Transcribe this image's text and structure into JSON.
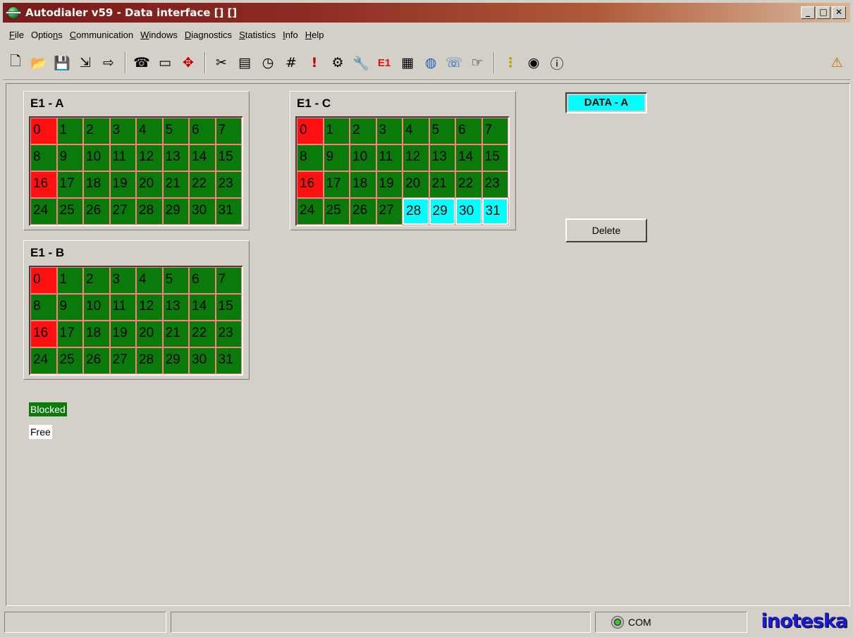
{
  "window": {
    "title": "Autodialer v59 - Data interface [] []",
    "minimize": "_",
    "maximize": "□",
    "close": "✕"
  },
  "menu": [
    {
      "pre": "",
      "mn": "F",
      "post": "ile"
    },
    {
      "pre": "Optio",
      "mn": "n",
      "post": "s"
    },
    {
      "pre": "",
      "mn": "C",
      "post": "ommunication"
    },
    {
      "pre": "",
      "mn": "W",
      "post": "indows"
    },
    {
      "pre": "",
      "mn": "D",
      "post": "iagnostics"
    },
    {
      "pre": "",
      "mn": "S",
      "post": "tatistics"
    },
    {
      "pre": "",
      "mn": "I",
      "post": "nfo"
    },
    {
      "pre": "",
      "mn": "H",
      "post": "elp"
    }
  ],
  "toolbar": {
    "new": "🗋",
    "open": "📂",
    "save": "💾",
    "import": "⇲",
    "export": "⇨",
    "phone_book": "☎",
    "chip": "▭",
    "navigate": "✥",
    "cut": "✂",
    "terminal": "▤",
    "clock": "◷",
    "number": "#",
    "alert": "!",
    "settings": "⚙",
    "tools": "🔧",
    "e1": "E1",
    "calendar": "▦",
    "globe": "◍",
    "cli_phone": "☏",
    "pointer": "☞",
    "traffic": "⋮",
    "sound": "◉",
    "info": "ⓘ",
    "help": "⚠"
  },
  "e1_a": {
    "title": "E1 - A",
    "slots": [
      {
        "n": "0",
        "s": "red"
      },
      {
        "n": "1",
        "s": "blocked"
      },
      {
        "n": "2",
        "s": "blocked"
      },
      {
        "n": "3",
        "s": "blocked"
      },
      {
        "n": "4",
        "s": "blocked"
      },
      {
        "n": "5",
        "s": "blocked"
      },
      {
        "n": "6",
        "s": "blocked"
      },
      {
        "n": "7",
        "s": "blocked"
      },
      {
        "n": "8",
        "s": "blocked"
      },
      {
        "n": "9",
        "s": "blocked"
      },
      {
        "n": "10",
        "s": "blocked"
      },
      {
        "n": "11",
        "s": "blocked"
      },
      {
        "n": "12",
        "s": "blocked"
      },
      {
        "n": "13",
        "s": "blocked"
      },
      {
        "n": "14",
        "s": "blocked"
      },
      {
        "n": "15",
        "s": "blocked"
      },
      {
        "n": "16",
        "s": "red"
      },
      {
        "n": "17",
        "s": "blocked"
      },
      {
        "n": "18",
        "s": "blocked"
      },
      {
        "n": "19",
        "s": "blocked"
      },
      {
        "n": "20",
        "s": "blocked"
      },
      {
        "n": "21",
        "s": "blocked"
      },
      {
        "n": "22",
        "s": "blocked"
      },
      {
        "n": "23",
        "s": "blocked"
      },
      {
        "n": "24",
        "s": "blocked"
      },
      {
        "n": "25",
        "s": "blocked"
      },
      {
        "n": "26",
        "s": "blocked"
      },
      {
        "n": "27",
        "s": "blocked"
      },
      {
        "n": "28",
        "s": "blocked"
      },
      {
        "n": "29",
        "s": "blocked"
      },
      {
        "n": "30",
        "s": "blocked"
      },
      {
        "n": "31",
        "s": "blocked"
      }
    ]
  },
  "e1_b": {
    "title": "E1 - B",
    "slots": [
      {
        "n": "0",
        "s": "red"
      },
      {
        "n": "1",
        "s": "blocked"
      },
      {
        "n": "2",
        "s": "blocked"
      },
      {
        "n": "3",
        "s": "blocked"
      },
      {
        "n": "4",
        "s": "blocked"
      },
      {
        "n": "5",
        "s": "blocked"
      },
      {
        "n": "6",
        "s": "blocked"
      },
      {
        "n": "7",
        "s": "blocked"
      },
      {
        "n": "8",
        "s": "blocked"
      },
      {
        "n": "9",
        "s": "blocked"
      },
      {
        "n": "10",
        "s": "blocked"
      },
      {
        "n": "11",
        "s": "blocked"
      },
      {
        "n": "12",
        "s": "blocked"
      },
      {
        "n": "13",
        "s": "blocked"
      },
      {
        "n": "14",
        "s": "blocked"
      },
      {
        "n": "15",
        "s": "blocked"
      },
      {
        "n": "16",
        "s": "red"
      },
      {
        "n": "17",
        "s": "blocked"
      },
      {
        "n": "18",
        "s": "blocked"
      },
      {
        "n": "19",
        "s": "blocked"
      },
      {
        "n": "20",
        "s": "blocked"
      },
      {
        "n": "21",
        "s": "blocked"
      },
      {
        "n": "22",
        "s": "blocked"
      },
      {
        "n": "23",
        "s": "blocked"
      },
      {
        "n": "24",
        "s": "blocked"
      },
      {
        "n": "25",
        "s": "blocked"
      },
      {
        "n": "26",
        "s": "blocked"
      },
      {
        "n": "27",
        "s": "blocked"
      },
      {
        "n": "28",
        "s": "blocked"
      },
      {
        "n": "29",
        "s": "blocked"
      },
      {
        "n": "30",
        "s": "blocked"
      },
      {
        "n": "31",
        "s": "blocked"
      }
    ]
  },
  "e1_c": {
    "title": "E1 - C",
    "slots": [
      {
        "n": "0",
        "s": "red"
      },
      {
        "n": "1",
        "s": "blocked"
      },
      {
        "n": "2",
        "s": "blocked"
      },
      {
        "n": "3",
        "s": "blocked"
      },
      {
        "n": "4",
        "s": "blocked"
      },
      {
        "n": "5",
        "s": "blocked"
      },
      {
        "n": "6",
        "s": "blocked"
      },
      {
        "n": "7",
        "s": "blocked"
      },
      {
        "n": "8",
        "s": "blocked"
      },
      {
        "n": "9",
        "s": "blocked"
      },
      {
        "n": "10",
        "s": "blocked"
      },
      {
        "n": "11",
        "s": "blocked"
      },
      {
        "n": "12",
        "s": "blocked"
      },
      {
        "n": "13",
        "s": "blocked"
      },
      {
        "n": "14",
        "s": "blocked"
      },
      {
        "n": "15",
        "s": "blocked"
      },
      {
        "n": "16",
        "s": "red"
      },
      {
        "n": "17",
        "s": "blocked"
      },
      {
        "n": "18",
        "s": "blocked"
      },
      {
        "n": "19",
        "s": "blocked"
      },
      {
        "n": "20",
        "s": "blocked"
      },
      {
        "n": "21",
        "s": "blocked"
      },
      {
        "n": "22",
        "s": "blocked"
      },
      {
        "n": "23",
        "s": "blocked"
      },
      {
        "n": "24",
        "s": "blocked"
      },
      {
        "n": "25",
        "s": "blocked"
      },
      {
        "n": "26",
        "s": "blocked"
      },
      {
        "n": "27",
        "s": "blocked"
      },
      {
        "n": "28",
        "s": "cyan"
      },
      {
        "n": "29",
        "s": "cyan"
      },
      {
        "n": "30",
        "s": "cyan"
      },
      {
        "n": "31",
        "s": "cyan"
      }
    ]
  },
  "data_label": "DATA - A",
  "delete_label": "Delete",
  "legend": {
    "blocked": "Blocked",
    "free": "Free"
  },
  "statusbar": {
    "com": "COM",
    "brand": "inoteska"
  },
  "colors": {
    "blocked": "#0a7a0a",
    "red": "#ff1010",
    "cyan": "#00ffff",
    "free": "#ffffff",
    "brand": "#1a1ad0"
  }
}
